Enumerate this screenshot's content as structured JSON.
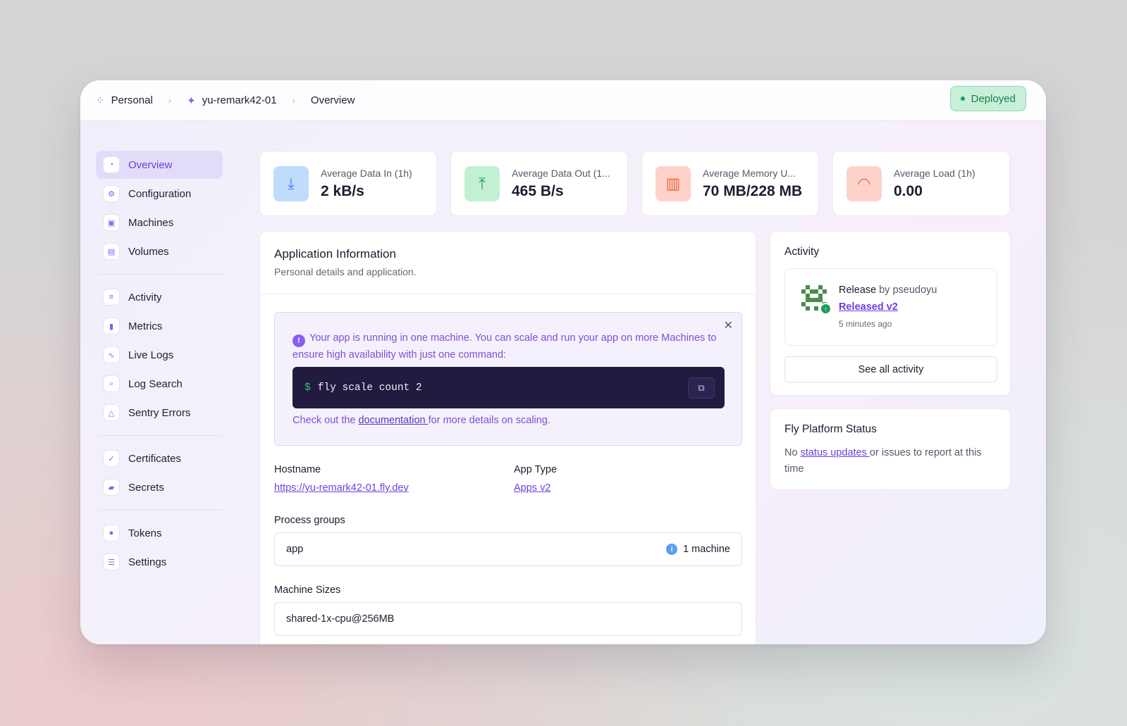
{
  "breadcrumb": {
    "org": "Personal",
    "app": "yu-remark42-01",
    "page": "Overview"
  },
  "status_badge": "Deployed",
  "sidebar": {
    "groups": [
      [
        {
          "label": "Overview",
          "icon": "overview-icon",
          "active": true
        },
        {
          "label": "Configuration",
          "icon": "gear-icon"
        },
        {
          "label": "Machines",
          "icon": "chip-icon"
        },
        {
          "label": "Volumes",
          "icon": "volume-icon"
        }
      ],
      [
        {
          "label": "Activity",
          "icon": "activity-icon"
        },
        {
          "label": "Metrics",
          "icon": "bar-chart-icon"
        },
        {
          "label": "Live Logs",
          "icon": "pulse-icon"
        },
        {
          "label": "Log Search",
          "icon": "search-icon"
        },
        {
          "label": "Sentry Errors",
          "icon": "sentry-icon"
        }
      ],
      [
        {
          "label": "Certificates",
          "icon": "certificate-icon"
        },
        {
          "label": "Secrets",
          "icon": "lock-icon"
        }
      ],
      [
        {
          "label": "Tokens",
          "icon": "token-icon"
        },
        {
          "label": "Settings",
          "icon": "settings-toggle-icon"
        }
      ]
    ]
  },
  "stats": [
    {
      "label": "Average Data In (1h)",
      "value": "2 kB/s",
      "icon": "download-icon",
      "bg": "#bfdcfb",
      "fg": "#3b82f6"
    },
    {
      "label": "Average Data Out (1...",
      "value": "465 B/s",
      "icon": "upload-icon",
      "bg": "#c2f0d2",
      "fg": "#1e9d56"
    },
    {
      "label": "Average Memory U...",
      "value": "70 MB/228 MB",
      "icon": "memory-icon",
      "bg": "#fdd3c9",
      "fg": "#f0643c"
    },
    {
      "label": "Average Load (1h)",
      "value": "0.00",
      "icon": "gauge-icon",
      "bg": "#fdd3c9",
      "fg": "#f0643c"
    }
  ],
  "app_info": {
    "title": "Application Information",
    "subtitle": "Personal details and application.",
    "notice": {
      "text": "Your app is running in one machine. You can scale and run your app on more Machines to ensure high availability with just one command:",
      "command_prompt": "$",
      "command": "fly scale count 2",
      "foot_before": "Check out the ",
      "foot_link": "documentation ",
      "foot_after": "for more details on scaling."
    },
    "hostname_label": "Hostname",
    "hostname": "https://yu-remark42-01.fly.dev",
    "app_type_label": "App Type",
    "app_type": "Apps v2",
    "process_groups_label": "Process groups",
    "process_group": "app",
    "process_group_count": "1 machine",
    "machine_sizes_label": "Machine Sizes",
    "machine_size": "shared-1x-cpu@256MB"
  },
  "activity": {
    "title": "Activity",
    "release_kind": "Release",
    "release_by": " by pseudoyu",
    "release_link": "Released v2",
    "release_time": "5 minutes ago",
    "see_all": "See all activity"
  },
  "platform_status": {
    "title": "Fly Platform Status",
    "before": "No ",
    "link": "status updates ",
    "after": "or issues to report at this time"
  }
}
